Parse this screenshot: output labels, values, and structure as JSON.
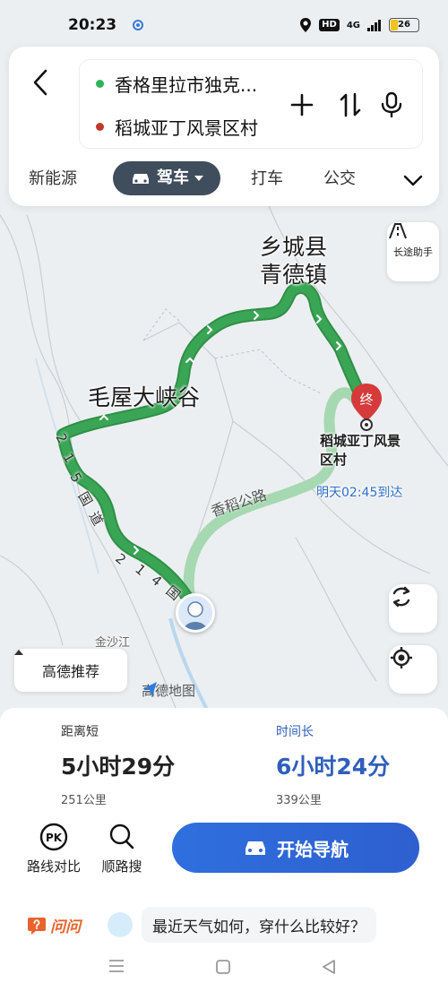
{
  "status_bar": {
    "time": "20:23",
    "hd_badge": "HD",
    "signal_label": "4G",
    "battery": "26"
  },
  "route_card": {
    "origin": "香格里拉市独克...",
    "destination": "稻城亚丁风景区村",
    "origin_color": "#2fb45a",
    "destination_color": "#c0392b"
  },
  "mode_tabs": {
    "new_energy": "新能源",
    "drive": "驾车",
    "taxi": "打车",
    "transit": "公交"
  },
  "map": {
    "region_label_line1": "乡城县",
    "region_label_line2": "青德镇",
    "canyon_label": "毛屋大峡谷",
    "destination_line1": "稻城亚丁风景",
    "destination_line2": "区村",
    "arrival": "明天02:45到达",
    "alt_road": "香稻公路",
    "river": "金沙江",
    "dest_pin_text": "终",
    "road_215": [
      "2",
      "1",
      "5",
      "国",
      "道"
    ],
    "road_214": [
      "2",
      "1",
      "4",
      "国"
    ],
    "long_trip_label": "长途助手",
    "recommend_label": "高德推荐",
    "logo_text": "高德地图",
    "route_color": "#3aa655",
    "alt_route_color": "#a6d8b2"
  },
  "routes": [
    {
      "tag": "距离短",
      "time": "5小时29分",
      "distance": "251公里"
    },
    {
      "tag": "时间长",
      "time": "6小时24分",
      "distance": "339公里"
    }
  ],
  "actions": {
    "compare_label": "路线对比",
    "compare_icon_text": "PK",
    "along_search_label": "顺路搜",
    "start_nav_label": "开始导航"
  },
  "ask": {
    "logo": "问问",
    "question": "最近天气如何，穿什么比较好？"
  }
}
